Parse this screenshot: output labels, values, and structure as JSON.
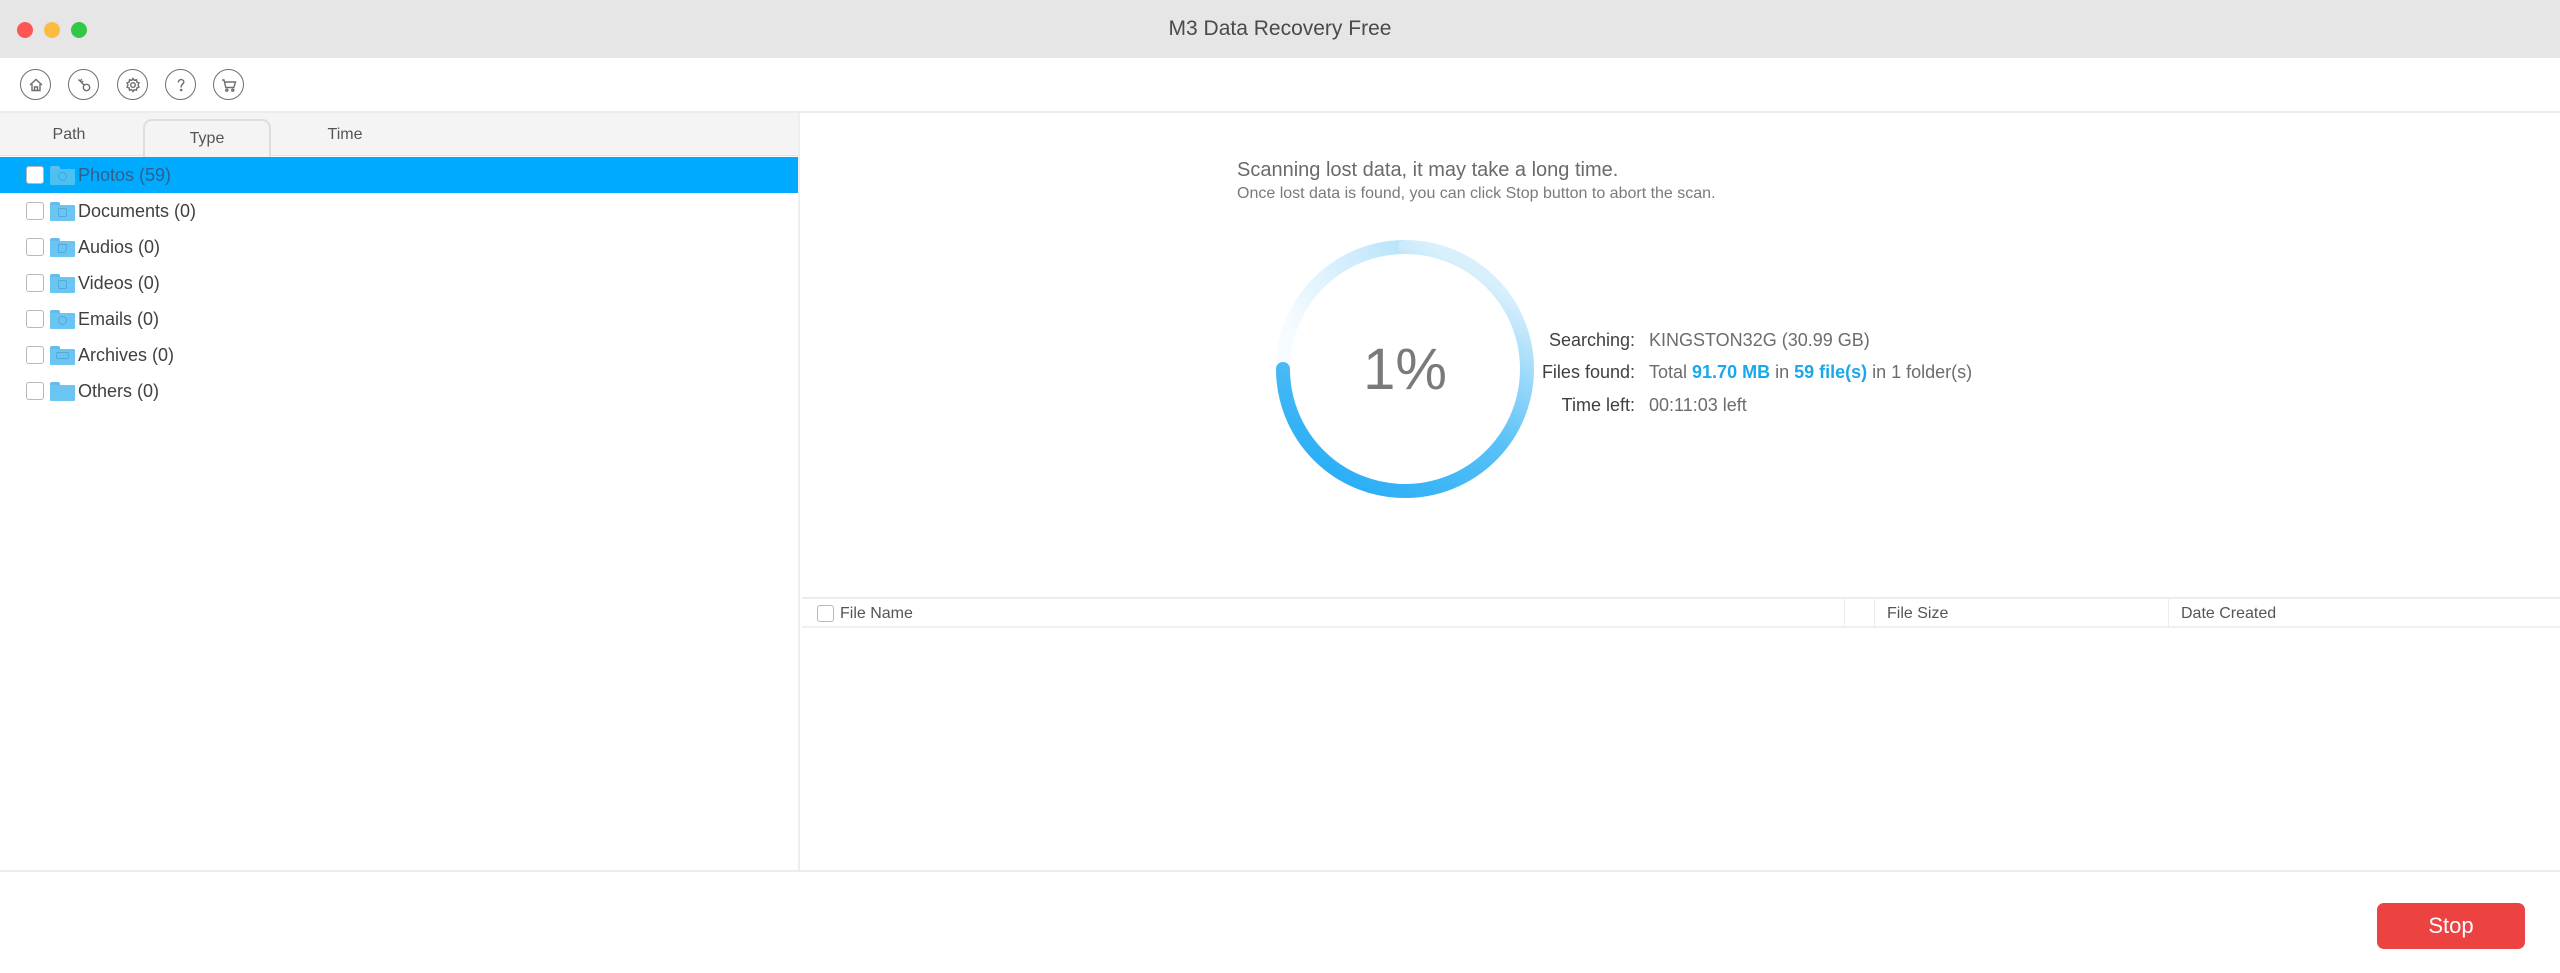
{
  "window": {
    "title": "M3 Data Recovery Free",
    "controls": [
      "close",
      "minimize",
      "maximize"
    ]
  },
  "toolbar": {
    "buttons": [
      {
        "name": "home",
        "icon": "home-icon"
      },
      {
        "name": "key",
        "icon": "key-icon"
      },
      {
        "name": "settings",
        "icon": "gear-icon"
      },
      {
        "name": "help",
        "icon": "question-icon"
      },
      {
        "name": "cart",
        "icon": "cart-icon"
      }
    ]
  },
  "sidebar": {
    "tabs": [
      {
        "label": "Path",
        "active": false
      },
      {
        "label": "Type",
        "active": true
      },
      {
        "label": "Time",
        "active": false
      }
    ],
    "items": [
      {
        "label": "Photos (59)",
        "selected": true,
        "checked": false,
        "icon": "photo-folder-icon"
      },
      {
        "label": "Documents (0)",
        "selected": false,
        "checked": false,
        "icon": "document-folder-icon"
      },
      {
        "label": "Audios (0)",
        "selected": false,
        "checked": false,
        "icon": "audio-folder-icon"
      },
      {
        "label": "Videos (0)",
        "selected": false,
        "checked": false,
        "icon": "video-folder-icon"
      },
      {
        "label": "Emails (0)",
        "selected": false,
        "checked": false,
        "icon": "email-folder-icon"
      },
      {
        "label": "Archives (0)",
        "selected": false,
        "checked": false,
        "icon": "archive-folder-icon"
      },
      {
        "label": "Others (0)",
        "selected": false,
        "checked": false,
        "icon": "folder-icon"
      }
    ]
  },
  "scan": {
    "heading": "Scanning lost data, it may take a long time.",
    "subheading": "Once lost data is found, you can click Stop button to abort the scan.",
    "progress_percent": 1,
    "progress_label": "1%",
    "info": {
      "searching_label": "Searching:",
      "searching_value": "KINGSTON32G (30.99 GB)",
      "files_found_label": "Files found:",
      "files_found_prefix": "Total ",
      "files_found_size": "91.70 MB",
      "files_found_mid": " in ",
      "files_found_count": "59 file(s)",
      "files_found_suffix": " in 1 folder(s)",
      "time_left_label": "Time left:",
      "time_left_value": "00:11:03 left"
    },
    "colors": {
      "accent": "#1aa7ec",
      "ring_start": "#1ba8f5",
      "ring_end": "#e8f5fd"
    }
  },
  "file_table": {
    "columns": [
      "File Name",
      "",
      "File Size",
      "Date Created"
    ],
    "rows": []
  },
  "footer": {
    "stop_label": "Stop",
    "stop_color": "#ec4242"
  }
}
